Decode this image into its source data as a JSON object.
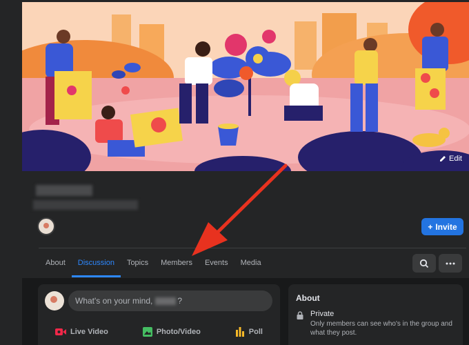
{
  "cover": {
    "edit_label": "Edit"
  },
  "header": {
    "invite_label": "Invite"
  },
  "tabs": [
    {
      "label": "About"
    },
    {
      "label": "Discussion"
    },
    {
      "label": "Topics"
    },
    {
      "label": "Members"
    },
    {
      "label": "Events"
    },
    {
      "label": "Media"
    }
  ],
  "active_tab": "Discussion",
  "composer": {
    "prompt_prefix": "What's on your mind,",
    "prompt_suffix": "?",
    "actions": [
      {
        "label": "Live Video",
        "icon": "live-video-icon",
        "color": "#f02849"
      },
      {
        "label": "Photo/Video",
        "icon": "photo-icon",
        "color": "#45bd62"
      },
      {
        "label": "Poll",
        "icon": "poll-icon",
        "color": "#f7b928"
      }
    ]
  },
  "about": {
    "title": "About",
    "privacy_label": "Private",
    "privacy_description": "Only members can see who's in the group and what they post."
  },
  "colors": {
    "accent": "#2d88ff",
    "button": "#2374e1",
    "annotation_arrow": "#e8321f"
  }
}
